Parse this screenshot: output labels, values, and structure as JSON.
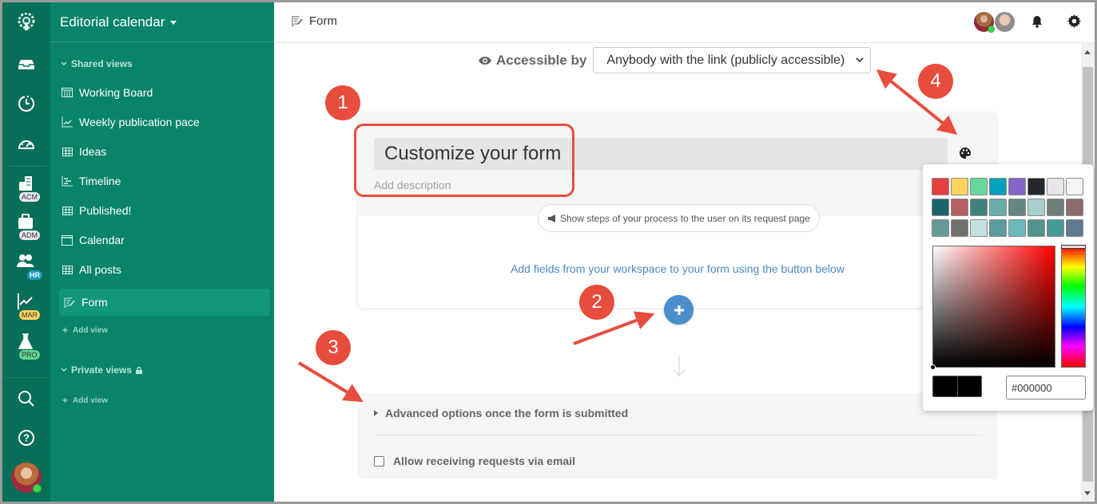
{
  "app": {
    "workspace_title": "Editorial calendar",
    "current_view": "Form"
  },
  "rail": {
    "items": [
      {
        "icon": "inbox-icon"
      },
      {
        "icon": "clock-icon"
      },
      {
        "icon": "dashboard-gauge-icon"
      }
    ],
    "workspaces": [
      {
        "icon": "buildings-icon",
        "badge": "ACM",
        "badge_color": "#e6e6f0"
      },
      {
        "icon": "briefcase-icon",
        "badge": "ADM",
        "badge_color": "#e6e6ea"
      },
      {
        "icon": "people-icon",
        "badge": "HR",
        "badge_color": "#1a9bbd"
      },
      {
        "icon": "chart-line-icon",
        "badge": "MAR",
        "badge_color": "#ffd45c"
      },
      {
        "icon": "flask-icon",
        "badge": "PRO",
        "badge_color": "#63d68f"
      }
    ],
    "bottom": [
      {
        "icon": "search-icon"
      },
      {
        "icon": "help-icon"
      }
    ]
  },
  "sidebar": {
    "shared_label": "Shared views",
    "private_label": "Private views",
    "add_view_label": "Add view",
    "views": [
      {
        "label": "Working Board",
        "icon": "board-icon",
        "active": false
      },
      {
        "label": "Weekly publication pace",
        "icon": "chart-icon",
        "active": false
      },
      {
        "label": "Ideas",
        "icon": "table-icon",
        "active": false
      },
      {
        "label": "Timeline",
        "icon": "timeline-icon",
        "active": false
      },
      {
        "label": "Published!",
        "icon": "table-icon",
        "active": false
      },
      {
        "label": "Calendar",
        "icon": "calendar-icon",
        "active": false
      },
      {
        "label": "All posts",
        "icon": "table-icon",
        "active": false
      },
      {
        "label": "Form",
        "icon": "form-icon",
        "active": true
      }
    ]
  },
  "topbar": {
    "title": "Form"
  },
  "access": {
    "label": "Accessible by",
    "selected": "Anybody with the link (publicly accessible)"
  },
  "form": {
    "title": "Customize your form",
    "description_placeholder": "Add description",
    "steps_button": "Show steps of your process to the user on its request page",
    "help_text": "Add fields from your workspace to your form using the button below"
  },
  "advanced": {
    "label": "Advanced options once the form is submitted",
    "email_checkbox_label": "Allow receiving requests via email",
    "email_checked": false
  },
  "color_picker": {
    "swatches": [
      "#e53e3e",
      "#ffd45c",
      "#66d99a",
      "#03a0bc",
      "#8466c8",
      "#23272f",
      "#e6e6ea",
      "#f3f3f8",
      "#1b636b",
      "#b56265",
      "#3f827d",
      "#69aeab",
      "#658683",
      "#a6cfcd",
      "#6f807c",
      "#8d6a6d",
      "#659a98",
      "#707070",
      "#c4dfdf",
      "#5a9c9e",
      "#68b9ba",
      "#4f948e",
      "#459a96",
      "#61798f"
    ],
    "hex_value": "#000000",
    "hue": "red"
  },
  "annotations": [
    "1",
    "2",
    "3",
    "4"
  ]
}
